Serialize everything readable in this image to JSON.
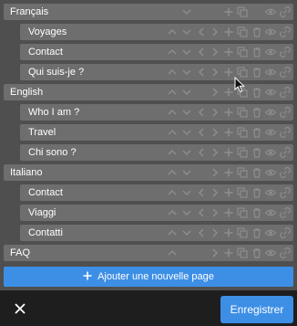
{
  "pages": [
    {
      "label": "Français",
      "level": 0,
      "tools": [
        "chevron-down",
        "plus",
        "copy",
        "eye",
        "link"
      ]
    },
    {
      "label": "Voyages",
      "level": 1,
      "tools": [
        "chevron-up",
        "chevron-down",
        "chevron-left",
        "chevron-right",
        "plus",
        "copy",
        "trash",
        "eye",
        "link"
      ]
    },
    {
      "label": "Contact",
      "level": 1,
      "tools": [
        "chevron-up",
        "chevron-down",
        "chevron-left",
        "chevron-right",
        "plus",
        "copy",
        "trash",
        "eye",
        "link"
      ]
    },
    {
      "label": "Qui suis-je ?",
      "level": 1,
      "tools": [
        "chevron-up",
        "chevron-down",
        "chevron-left",
        "chevron-right",
        "plus",
        "copy",
        "trash",
        "eye",
        "link"
      ]
    },
    {
      "label": "English",
      "level": 0,
      "tools": [
        "chevron-up",
        "chevron-down",
        "chevron-right",
        "plus",
        "copy",
        "trash",
        "eye",
        "link"
      ]
    },
    {
      "label": "Who I am ?",
      "level": 1,
      "tools": [
        "chevron-up",
        "chevron-down",
        "chevron-left",
        "chevron-right",
        "plus",
        "copy",
        "trash",
        "eye",
        "link"
      ]
    },
    {
      "label": "Travel",
      "level": 1,
      "tools": [
        "chevron-up",
        "chevron-down",
        "chevron-left",
        "chevron-right",
        "plus",
        "copy",
        "trash",
        "eye",
        "link"
      ]
    },
    {
      "label": "Chi sono ?",
      "level": 1,
      "tools": [
        "chevron-up",
        "chevron-down",
        "chevron-left",
        "chevron-right",
        "plus",
        "copy",
        "trash",
        "eye",
        "link"
      ]
    },
    {
      "label": "Italiano",
      "level": 0,
      "tools": [
        "chevron-up",
        "chevron-down",
        "chevron-right",
        "plus",
        "copy",
        "trash",
        "eye",
        "link"
      ]
    },
    {
      "label": "Contact",
      "level": 1,
      "tools": [
        "chevron-up",
        "chevron-down",
        "chevron-left",
        "chevron-right",
        "plus",
        "copy",
        "trash",
        "eye",
        "link"
      ]
    },
    {
      "label": "Viaggi",
      "level": 1,
      "tools": [
        "chevron-up",
        "chevron-down",
        "chevron-left",
        "chevron-right",
        "plus",
        "copy",
        "trash",
        "eye",
        "link"
      ]
    },
    {
      "label": "Contatti",
      "level": 1,
      "tools": [
        "chevron-up",
        "chevron-down",
        "chevron-left",
        "chevron-right",
        "plus",
        "copy",
        "trash",
        "eye",
        "link"
      ]
    },
    {
      "label": "FAQ",
      "level": 0,
      "tools": [
        "chevron-up",
        "chevron-right",
        "plus",
        "copy",
        "trash",
        "eye",
        "link"
      ]
    }
  ],
  "add_page_button": {
    "label": "Ajouter une nouvelle page",
    "icon": "plus-icon"
  },
  "close_button": {
    "icon": "close-icon"
  },
  "save_button": {
    "label": "Enregistrer"
  },
  "colors": {
    "accent": "#3d8fe6",
    "row": "#6e6e6e",
    "panel": "#4f4f4f",
    "background": "#1e1e1e",
    "icon": "#8d8d8d"
  }
}
